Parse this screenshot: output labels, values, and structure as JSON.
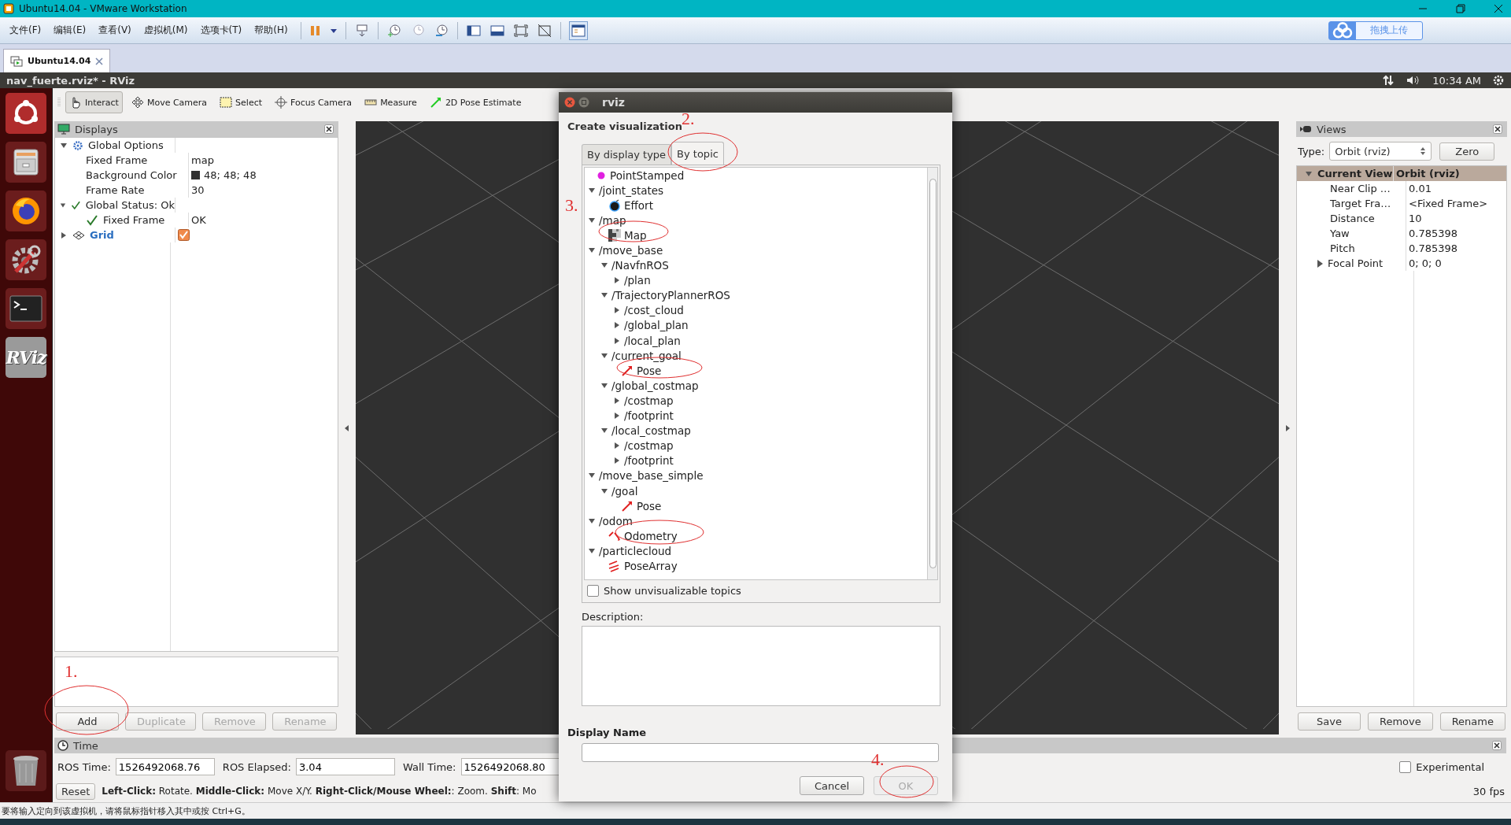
{
  "vm_window": {
    "title": "Ubuntu14.04 - VMware Workstation"
  },
  "vm_menu": [
    "文件(F)",
    "编辑(E)",
    "查看(V)",
    "虚拟机(M)",
    "选项卡(T)",
    "帮助(H)"
  ],
  "upload_button": "拖拽上传",
  "vm_tabs": [
    {
      "label": "Ubuntu14.04",
      "selected": true
    }
  ],
  "ubuntu_bar": {
    "title": "nav_fuerte.rviz* - RViz",
    "clock": "10:34 AM"
  },
  "launcher": [
    {
      "kind": "dash"
    },
    {
      "kind": "files"
    },
    {
      "kind": "browser"
    },
    {
      "kind": "settings"
    },
    {
      "kind": "terminal"
    },
    {
      "kind": "rviz",
      "label": "RViz"
    },
    {
      "kind": "trash"
    }
  ],
  "toolbar": [
    {
      "label": "Interact",
      "kind": "interact",
      "selected": true
    },
    {
      "label": "Move Camera",
      "kind": "move",
      "selected": false
    },
    {
      "label": "Select",
      "kind": "select",
      "selected": false
    },
    {
      "label": "Focus Camera",
      "kind": "focus",
      "selected": false
    },
    {
      "label": "Measure",
      "kind": "measure",
      "selected": false
    },
    {
      "label": "2D Pose Estimate",
      "kind": "pose",
      "selected": false
    }
  ],
  "displays": {
    "title": "Displays",
    "tree": [
      {
        "name": "Global Options",
        "kind": "group",
        "expanded": true,
        "children": [
          {
            "name": "Fixed Frame",
            "kind": "property",
            "value": "map"
          },
          {
            "name": "Background Color",
            "kind": "property",
            "value": "48; 48; 48",
            "color": "#303030"
          },
          {
            "name": "Frame Rate",
            "kind": "property",
            "value": "30"
          }
        ]
      },
      {
        "name": "Global Status: Ok",
        "kind": "status",
        "expanded": true,
        "children": [
          {
            "name": "Fixed Frame",
            "kind": "status",
            "value": "OK"
          }
        ]
      },
      {
        "name": "Grid",
        "kind": "display",
        "expanded": false,
        "checked": true
      }
    ],
    "buttons": [
      {
        "label": "Add",
        "disabled": false
      },
      {
        "label": "Duplicate",
        "disabled": true
      },
      {
        "label": "Remove",
        "disabled": true
      },
      {
        "label": "Rename",
        "disabled": true
      }
    ]
  },
  "views": {
    "title": "Views",
    "type_label": "Type:",
    "type_value": "Orbit (rviz)",
    "zero": "Zero",
    "header": {
      "name": "Current View",
      "value": "Orbit (rviz)",
      "expanded": true
    },
    "rows": [
      {
        "name": "Near Clip …",
        "value": "0.01"
      },
      {
        "name": "Target Fra…",
        "value": "<Fixed Frame>"
      },
      {
        "name": "Distance",
        "value": "10"
      },
      {
        "name": "Yaw",
        "value": "0.785398"
      },
      {
        "name": "Pitch",
        "value": "0.785398"
      },
      {
        "name": "Focal Point",
        "value": "0; 0; 0",
        "expanded": false
      }
    ],
    "buttons": [
      "Save",
      "Remove",
      "Rename"
    ]
  },
  "time_panel": {
    "title": "Time",
    "ros_time_label": "ROS Time:",
    "ros_time": "1526492068.76",
    "ros_elapsed_label": "ROS Elapsed:",
    "ros_elapsed": "3.04",
    "wall_time_label": "Wall Time:",
    "wall_time": "1526492068.80",
    "experimental": {
      "label": "Experimental",
      "checked": false
    }
  },
  "help_bar": {
    "reset": "Reset",
    "text": "**Left-Click:** Rotate. **Middle-Click:** Move X/Y. **Right-Click/Mouse Wheel:**: Zoom. **Shift**: Mo",
    "fps": "30 fps"
  },
  "dialog": {
    "title": "rviz",
    "heading": "Create visualization",
    "tabs": [
      {
        "label": "By display type",
        "selected": false
      },
      {
        "label": "By topic",
        "selected": true
      }
    ],
    "topics": [
      {
        "name": "PointStamped",
        "kind": "point"
      },
      {
        "name": "/joint_states",
        "kind": "topic",
        "expanded": true,
        "children": [
          {
            "name": "Effort",
            "kind": "effort"
          }
        ]
      },
      {
        "name": "/map",
        "kind": "topic",
        "expanded": true,
        "children": [
          {
            "name": "Map",
            "kind": "map"
          }
        ]
      },
      {
        "name": "/move_base",
        "kind": "topic",
        "expanded": true,
        "children": [
          {
            "name": "/NavfnROS",
            "kind": "topic",
            "expanded": true,
            "children": [
              {
                "name": "/plan",
                "kind": "topic",
                "expanded": false
              }
            ]
          },
          {
            "name": "/TrajectoryPlannerROS",
            "kind": "topic",
            "expanded": true,
            "children": [
              {
                "name": "/cost_cloud",
                "kind": "topic",
                "expanded": false
              },
              {
                "name": "/global_plan",
                "kind": "topic",
                "expanded": false
              },
              {
                "name": "/local_plan",
                "kind": "topic",
                "expanded": false
              }
            ]
          },
          {
            "name": "/current_goal",
            "kind": "topic",
            "expanded": true,
            "children": [
              {
                "name": "Pose",
                "kind": "pose"
              }
            ]
          },
          {
            "name": "/global_costmap",
            "kind": "topic",
            "expanded": true,
            "children": [
              {
                "name": "/costmap",
                "kind": "topic",
                "expanded": false
              },
              {
                "name": "/footprint",
                "kind": "topic",
                "expanded": false
              }
            ]
          },
          {
            "name": "/local_costmap",
            "kind": "topic",
            "expanded": true,
            "children": [
              {
                "name": "/costmap",
                "kind": "topic",
                "expanded": false
              },
              {
                "name": "/footprint",
                "kind": "topic",
                "expanded": false
              }
            ]
          }
        ]
      },
      {
        "name": "/move_base_simple",
        "kind": "topic",
        "expanded": true,
        "children": [
          {
            "name": "/goal",
            "kind": "topic",
            "expanded": true,
            "children": [
              {
                "name": "Pose",
                "kind": "pose"
              }
            ]
          }
        ]
      },
      {
        "name": "/odom",
        "kind": "topic",
        "expanded": true,
        "children": [
          {
            "name": "Odometry",
            "kind": "odometry"
          }
        ]
      },
      {
        "name": "/particlecloud",
        "kind": "topic",
        "expanded": true,
        "children": [
          {
            "name": "PoseArray",
            "kind": "posearray"
          }
        ]
      }
    ],
    "show_unvisualizable": {
      "label": "Show unvisualizable topics",
      "checked": false
    },
    "description_label": "Description:",
    "display_name_label": "Display Name",
    "buttons": [
      {
        "label": "Cancel",
        "disabled": false
      },
      {
        "label": "OK",
        "disabled": true
      }
    ]
  },
  "annotations": [
    "1.",
    "2.",
    "3.",
    "4."
  ],
  "vm_status": "要将输入定向到该虚拟机，请将鼠标指针移入其中或按 Ctrl+G。"
}
